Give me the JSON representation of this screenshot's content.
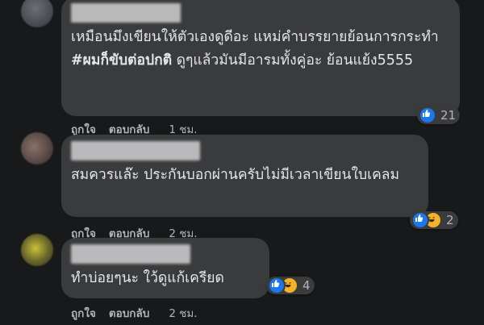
{
  "comments": [
    {
      "text_pre": "เหมือนมึงเขียนให้ตัวเองดูดีอะ แหม่คำบรรยายย้อนการกระทำ ",
      "hashtag": "#ผมก็ขับต่อปกติ",
      "text_post": " ดูๆแล้วมันมีอารมทั้งคู่อะ ย้อนแย้ง5555",
      "reaction_count": "21",
      "like_label": "ถูกใจ",
      "reply_label": "ตอบกลับ",
      "time": "1 ชม."
    },
    {
      "text": "สมควรแล๊ะ ประกันบอกผ่านครับไม่มีเวลาเขียนใบเคลม",
      "reaction_count": "2",
      "like_label": "ถูกใจ",
      "reply_label": "ตอบกลับ",
      "time": "2 ชม."
    },
    {
      "text": "ทำบ่อยๆนะ ใว้ดูแก้เครียด",
      "reaction_count": "4",
      "like_label": "ถูกใจ",
      "reply_label": "ตอบกลับ",
      "time": "2 ชม."
    }
  ],
  "colors": {
    "background": "#18191a",
    "bubble": "#3a3b3c",
    "text": "#e4e6eb",
    "secondary": "#b0b3b8",
    "like": "#1877f2",
    "haha": "#f7b125"
  }
}
